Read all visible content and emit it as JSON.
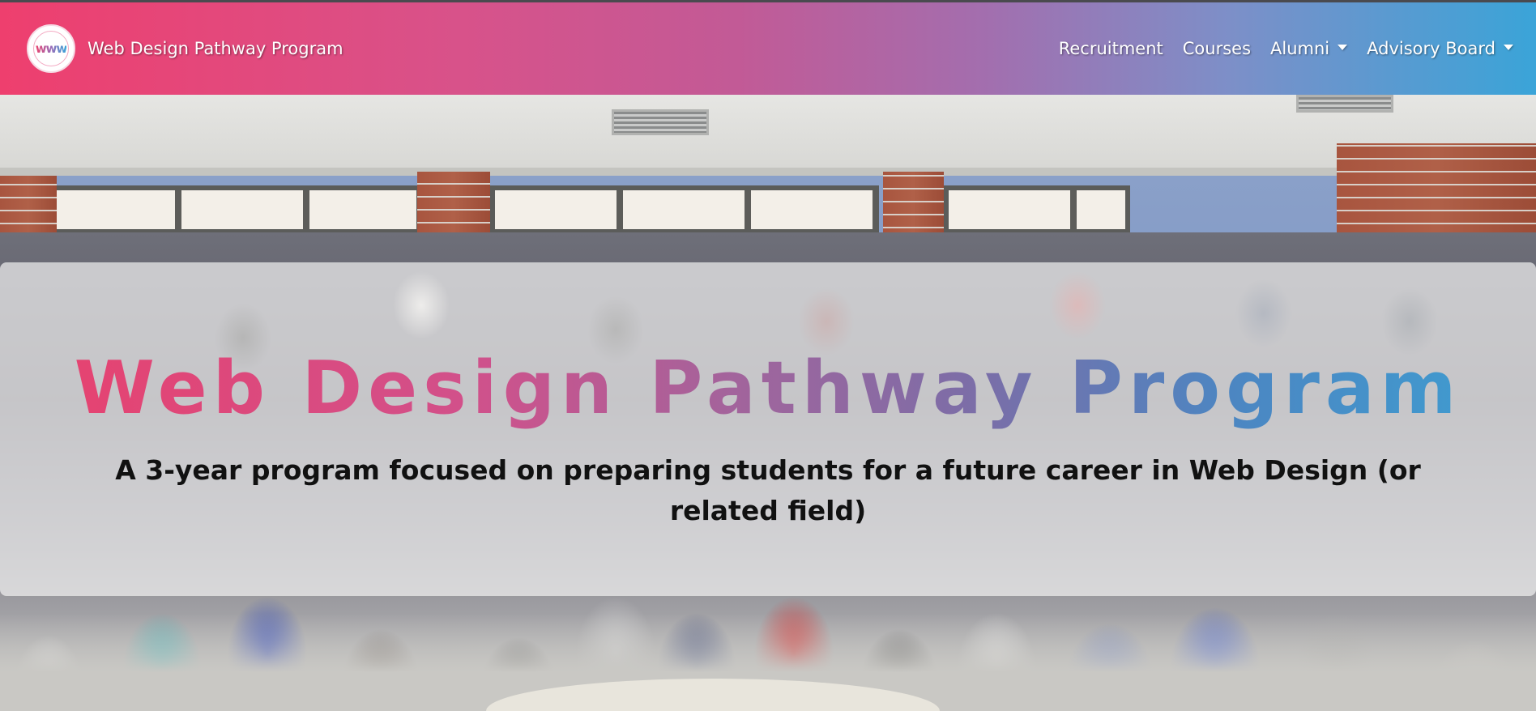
{
  "navbar": {
    "logo_text": "www",
    "brand_name": "Web Design Pathway Program",
    "links": [
      {
        "label": "Recruitment",
        "dropdown": false
      },
      {
        "label": "Courses",
        "dropdown": false
      },
      {
        "label": "Alumni",
        "dropdown": true
      },
      {
        "label": "Advisory Board",
        "dropdown": true
      }
    ],
    "gradient_colors": [
      "#ee3f6e",
      "#c25a96",
      "#a36eae",
      "#3aa4d8"
    ]
  },
  "hero": {
    "title": "Web Design Pathway Program",
    "subtitle": "A 3-year program focused on preparing students for a future career in Web Design (or related field)",
    "title_gradient_colors": [
      "#e8416d",
      "#a2649c",
      "#3d9fd2"
    ],
    "background_image": "group-photo"
  }
}
